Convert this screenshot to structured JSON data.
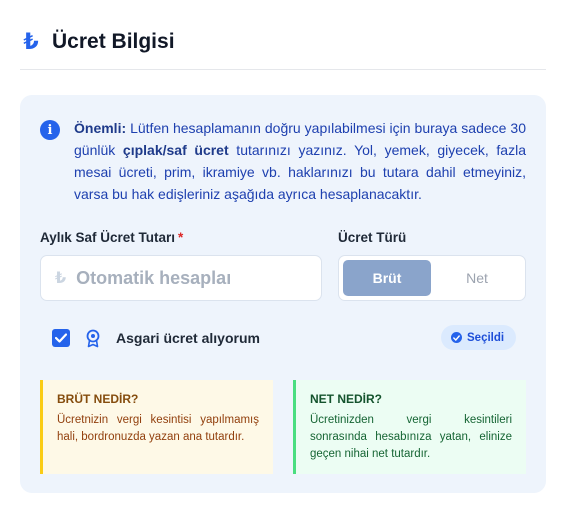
{
  "header": {
    "icon": "lira-icon",
    "title": "Ücret Bilgisi"
  },
  "info": {
    "icon": "info-icon",
    "strong_label": "Önemli:",
    "text_1": " Lütfen hesaplamanın doğru yapılabilmesi için buraya sadece 30 günlük ",
    "emphasis": "çıplak/saf ücret",
    "text_2": " tutarınızı yazınız. Yol, yemek, giyecek, fazla mesai ücreti, prim, ikramiye vb. haklarınızı bu tutara dahil etmeyiniz, varsa bu hak edişleriniz aşağıda ayrıca hesaplanacaktır."
  },
  "form": {
    "amount_label": "Aylık Saf Ücret Tutarı",
    "required_mark": "*",
    "amount_placeholder": "Otomatik hesaplaı",
    "amount_value": "",
    "currency_symbol": "₺",
    "type_label": "Ücret Türü",
    "type_options": [
      "Brüt",
      "Net"
    ],
    "type_selected": "Brüt"
  },
  "min_wage": {
    "checked": true,
    "label": "Asgari ücret alıyorum",
    "badge_icon": "award-icon",
    "status": "Seçildi"
  },
  "explanations": {
    "brut": {
      "title": "BRÜT NEDİR?",
      "text": "Ücretnizin vergi kesintisi yapılmamış hali, bordronuzda yazan ana tutardır."
    },
    "net": {
      "title": "NET NEDİR?",
      "text": "Ücretinizden vergi kesintileri sonrasında hesabınıza yatan, elinize geçen nihai net tutardır."
    }
  },
  "colors": {
    "accent": "#2563eb",
    "card_bg": "#eef4fc",
    "segment_active": "#8aa4cb",
    "brut_border": "#facc15",
    "net_border": "#4ade80"
  }
}
